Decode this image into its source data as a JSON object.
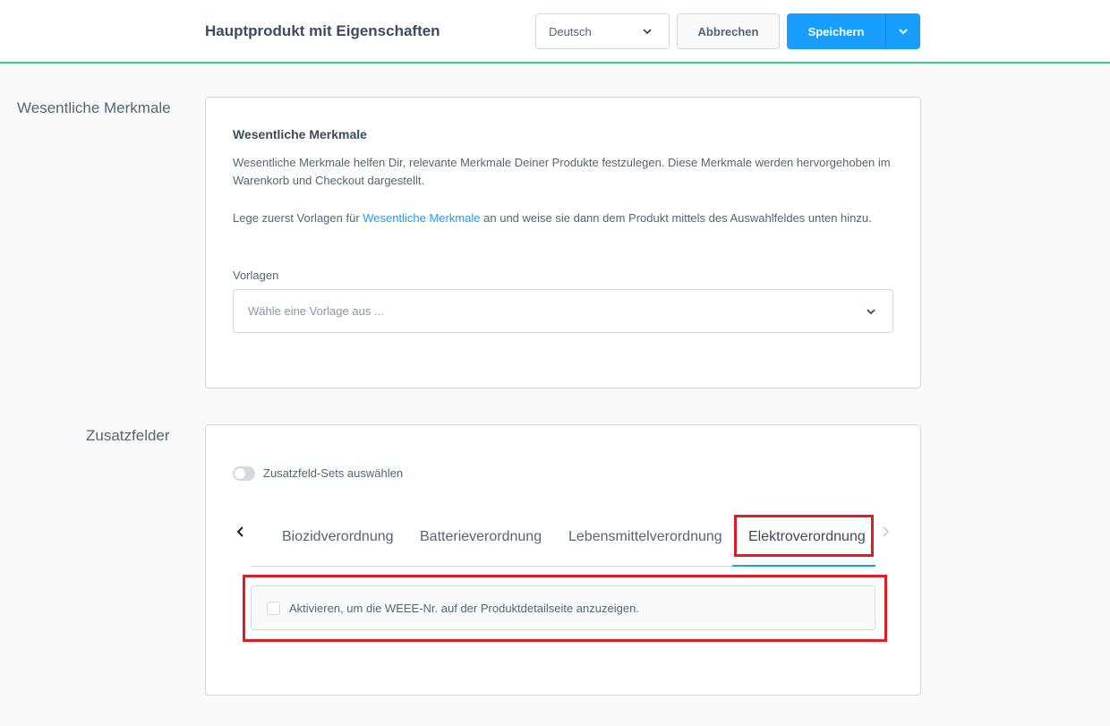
{
  "header": {
    "title": "Hauptprodukt mit Eigenschaften",
    "language_value": "Deutsch",
    "cancel_label": "Abbrechen",
    "save_label": "Speichern"
  },
  "essential_features": {
    "section_label": "Wesentliche Merkmale",
    "heading": "Wesentliche Merkmale",
    "description": "Wesentliche Merkmale helfen Dir, relevante Merkmale Deiner Produkte festzulegen. Diese Merkmale werden hervorgehoben im Warenkorb und Checkout dargestellt.",
    "hint_before": "Lege zuerst Vorlagen für ",
    "hint_link": "Wesentliche Merkmale",
    "hint_after": " an und weise sie dann dem Produkt mittels des Auswahlfeldes unten hinzu.",
    "templates_label": "Vorlagen",
    "templates_placeholder": "Wähle eine Vorlage aus ..."
  },
  "custom_fields": {
    "section_label": "Zusatzfelder",
    "toggle_label": "Zusatzfeld-Sets auswählen",
    "tabs": [
      {
        "label": "Biozidverordnung"
      },
      {
        "label": "Batterieverordnung"
      },
      {
        "label": "Lebensmittelverordnung"
      },
      {
        "label": "Elektroverordnung"
      }
    ],
    "active_tab": "Elektroverordnung",
    "weee_checkbox_label": "Aktivieren, um die WEEE-Nr. auf der Produktdetailseite anzuzeigen."
  },
  "colors": {
    "primary": "#189eff",
    "accent_line": "#3ec990",
    "highlight": "#e01b24"
  }
}
